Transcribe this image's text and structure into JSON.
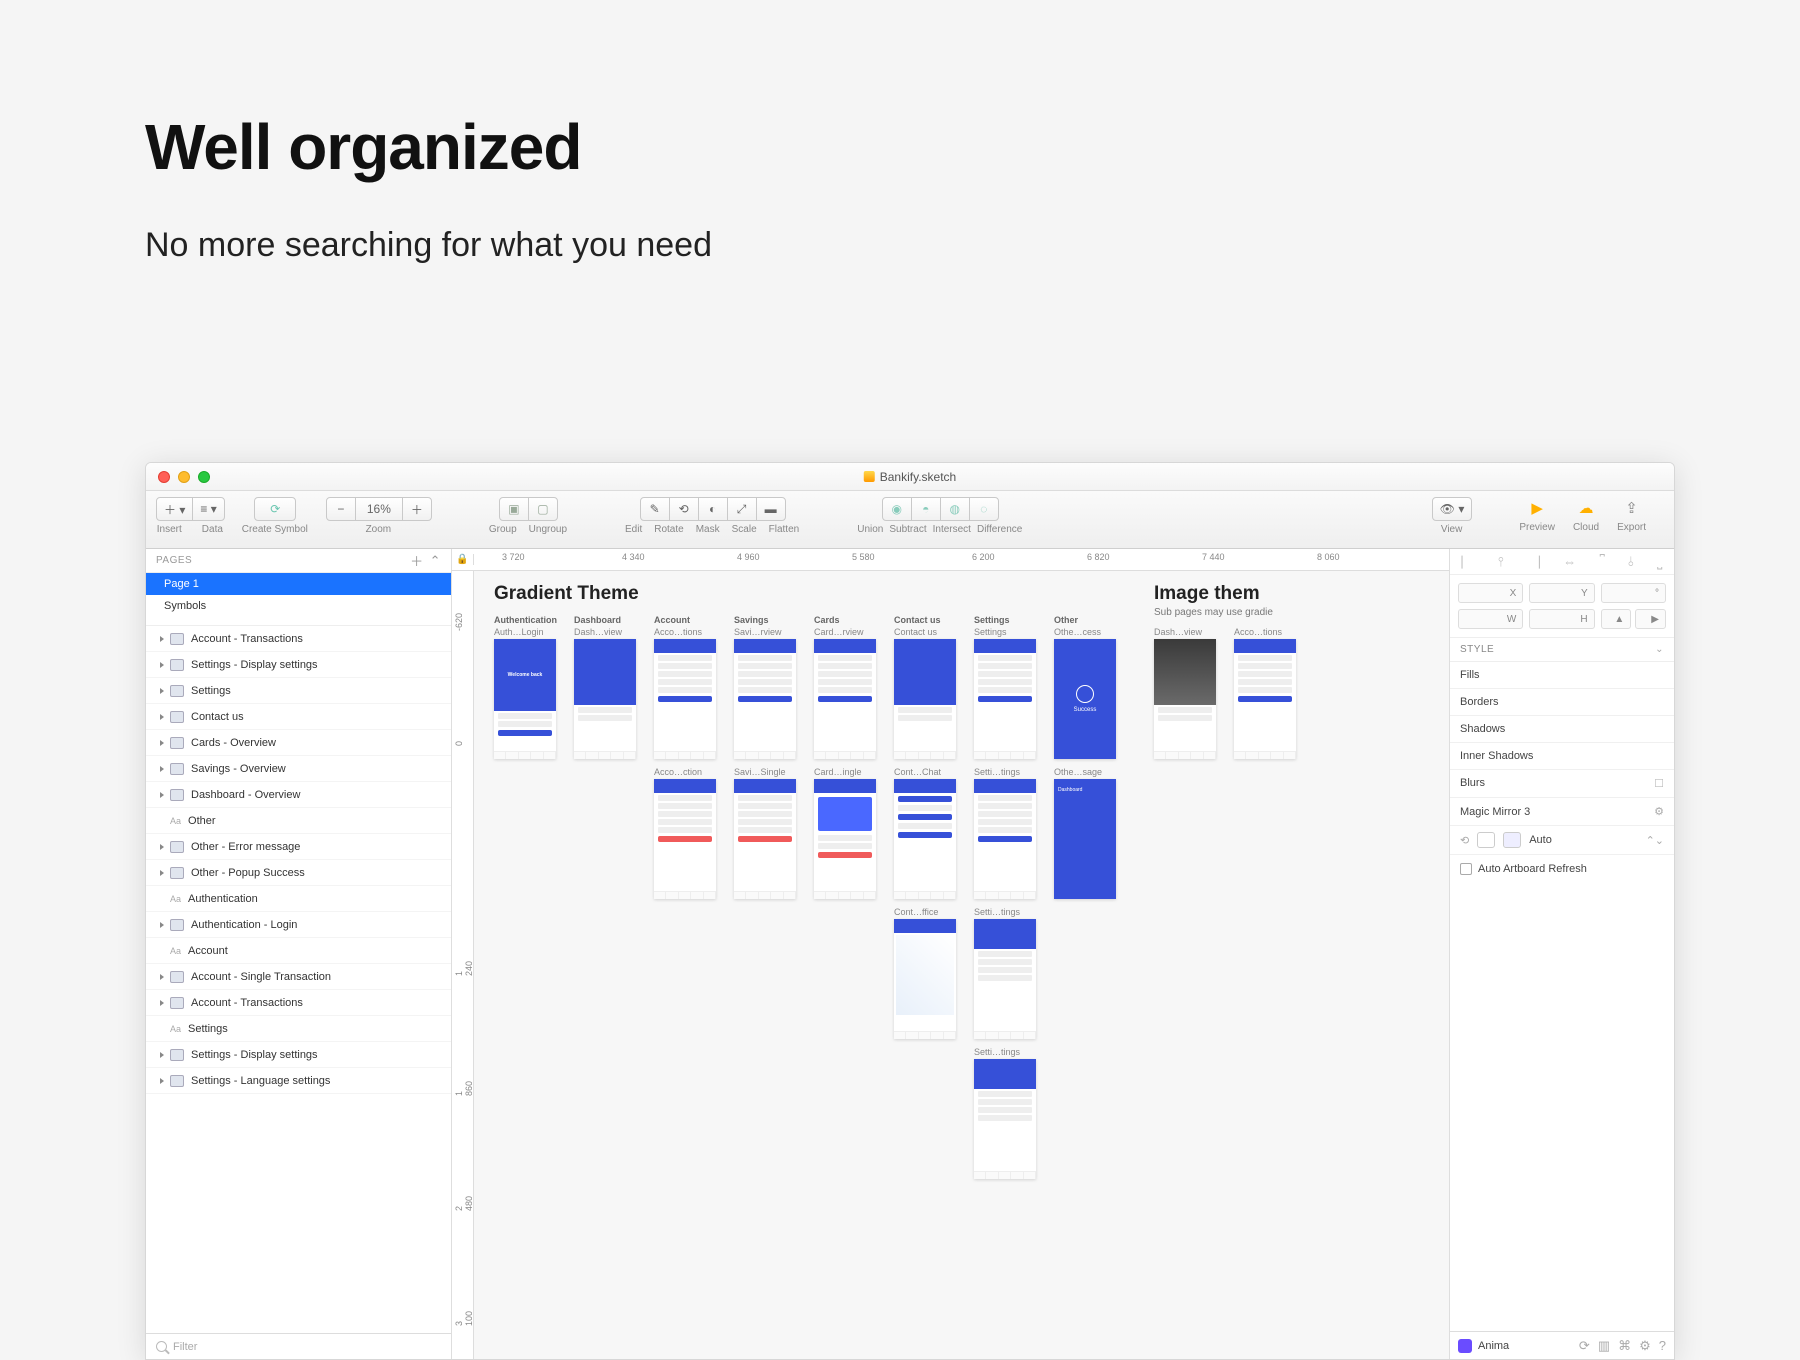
{
  "hero": {
    "title": "Well organized",
    "subtitle": "No more searching for what you need"
  },
  "titlebar": {
    "filename": "Bankify.sketch"
  },
  "toolbar": {
    "insert": "Insert",
    "data": "Data",
    "create_symbol": "Create Symbol",
    "zoom": "Zoom",
    "zoom_value": "16%",
    "group": "Group",
    "ungroup": "Ungroup",
    "edit": "Edit",
    "rotate": "Rotate",
    "mask": "Mask",
    "scale": "Scale",
    "flatten": "Flatten",
    "union": "Union",
    "subtract": "Subtract",
    "intersect": "Intersect",
    "difference": "Difference",
    "view": "View",
    "preview": "Preview",
    "cloud": "Cloud",
    "export": "Export"
  },
  "leftpanel": {
    "pages_header": "PAGES",
    "pages": [
      "Page 1",
      "Symbols"
    ],
    "layers": [
      {
        "t": "artboard",
        "label": "Account - Transactions"
      },
      {
        "t": "artboard",
        "label": "Settings - Display settings"
      },
      {
        "t": "artboard",
        "label": "Settings"
      },
      {
        "t": "artboard",
        "label": "Contact us"
      },
      {
        "t": "artboard",
        "label": "Cards - Overview"
      },
      {
        "t": "artboard",
        "label": "Savings - Overview"
      },
      {
        "t": "artboard",
        "label": "Dashboard - Overview"
      },
      {
        "t": "text",
        "label": "Other"
      },
      {
        "t": "artboard",
        "label": "Other - Error message"
      },
      {
        "t": "artboard",
        "label": "Other - Popup Success"
      },
      {
        "t": "text",
        "label": "Authentication"
      },
      {
        "t": "artboard",
        "label": "Authentication - Login"
      },
      {
        "t": "text",
        "label": "Account"
      },
      {
        "t": "artboard",
        "label": "Account - Single Transaction"
      },
      {
        "t": "artboard",
        "label": "Account - Transactions"
      },
      {
        "t": "text",
        "label": "Settings"
      },
      {
        "t": "artboard",
        "label": "Settings - Display settings"
      },
      {
        "t": "artboard",
        "label": "Settings - Language settings"
      }
    ],
    "filter_placeholder": "Filter"
  },
  "hruler_ticks": [
    "3 720",
    "4 340",
    "4 960",
    "5 580",
    "6 200",
    "6 820",
    "7 440",
    "8 060"
  ],
  "vruler_ticks": [
    "-620",
    "0",
    "1 240",
    "1 860",
    "2 480",
    "3 100"
  ],
  "canvas": {
    "section1_title": "Gradient Theme",
    "section2_title": "Image them",
    "section2_sub": "Sub pages may use gradie",
    "columns": [
      "Authentication",
      "Dashboard",
      "Account",
      "Savings",
      "Cards",
      "Contact us",
      "Settings",
      "Other"
    ],
    "row1_labels": [
      "Auth…Login",
      "Dash…view",
      "Acco…tions",
      "Savi…rview",
      "Card…rview",
      "Contact us",
      "Settings",
      "Othe…cess"
    ],
    "row2_labels": [
      "Acco…ction",
      "Savi…Single",
      "Card…ingle",
      "Cont…Chat",
      "Setti…tings",
      "Othe…sage"
    ],
    "row3_labels": [
      "Cont…ffice",
      "Setti…tings"
    ],
    "row4_labels": [
      "Setti…tings"
    ],
    "welcome_text": "Welcome back",
    "success_text": "Success",
    "img_labels": [
      "Dash…view",
      "Acco…tions"
    ]
  },
  "rightpanel": {
    "coord_labels": [
      "X",
      "Y",
      "°",
      "W",
      "H"
    ],
    "style_header": "STYLE",
    "props": [
      "Fills",
      "Borders",
      "Shadows",
      "Inner Shadows",
      "Blurs"
    ],
    "magic_mirror": "Magic Mirror 3",
    "auto_label": "Auto",
    "auto_refresh": "Auto Artboard Refresh",
    "anima": "Anima"
  }
}
